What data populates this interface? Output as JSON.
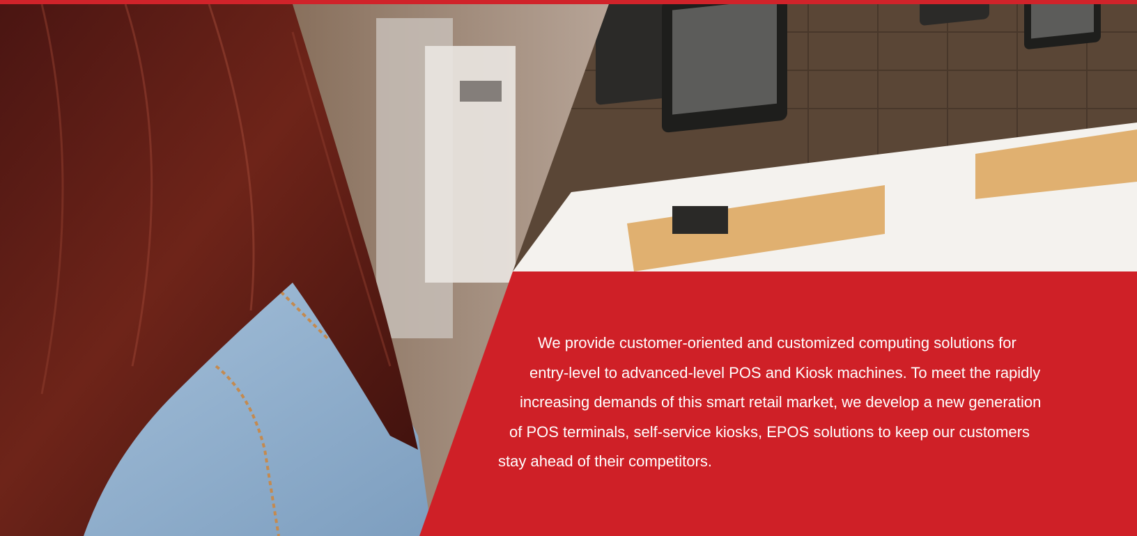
{
  "brand": {
    "accent": "#cf2027"
  },
  "photos": {
    "left": "person with long red-brown hair in denim jacket",
    "right": "POS terminals on white counter with wooden stands"
  },
  "intro": {
    "lines": [
      "We provide customer-oriented and customized computing solutions for",
      "entry-level to advanced-level POS and Kiosk machines. To meet the rapidly",
      "increasing demands of this smart retail market, we develop a new generation",
      "of POS terminals, self-service kiosks, EPOS solutions to keep our customers",
      "stay ahead of their competitors."
    ]
  }
}
